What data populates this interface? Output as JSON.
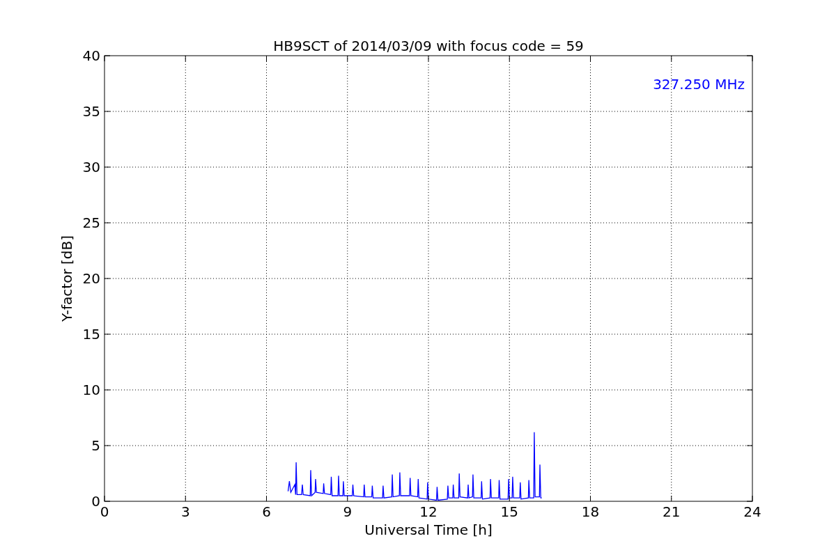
{
  "chart_data": {
    "type": "line",
    "title": "HB9SCT of 2014/03/09 with focus code = 59",
    "xlabel": "Universal Time [h]",
    "ylabel": "Y-factor [dB]",
    "xlim": [
      0,
      24
    ],
    "ylim": [
      0,
      40
    ],
    "xticks": [
      0,
      3,
      6,
      9,
      12,
      15,
      18,
      21,
      24
    ],
    "yticks": [
      0,
      5,
      10,
      15,
      20,
      25,
      30,
      35,
      40
    ],
    "grid": true,
    "annotations": [
      {
        "text": "327.250 MHz"
      }
    ],
    "x": [
      6.8,
      6.85,
      6.9,
      7.05,
      7.08,
      7.1,
      7.13,
      7.3,
      7.33,
      7.36,
      7.62,
      7.64,
      7.67,
      7.8,
      7.82,
      7.85,
      8.1,
      8.12,
      8.15,
      8.38,
      8.4,
      8.43,
      8.65,
      8.67,
      8.7,
      8.83,
      8.85,
      8.88,
      9.18,
      9.2,
      9.23,
      9.6,
      9.62,
      9.65,
      9.9,
      9.92,
      9.95,
      10.3,
      10.32,
      10.35,
      10.64,
      10.66,
      10.69,
      10.92,
      10.94,
      10.97,
      11.3,
      11.32,
      11.35,
      11.6,
      11.62,
      11.65,
      11.95,
      11.97,
      12.0,
      12.3,
      12.32,
      12.35,
      12.7,
      12.72,
      12.75,
      12.9,
      12.92,
      12.95,
      13.12,
      13.14,
      13.17,
      13.45,
      13.47,
      13.5,
      13.63,
      13.65,
      13.68,
      13.95,
      13.97,
      14.0,
      14.28,
      14.3,
      14.33,
      14.6,
      14.62,
      14.65,
      14.95,
      14.97,
      15.0,
      15.1,
      15.12,
      15.15,
      15.38,
      15.4,
      15.43,
      15.7,
      15.72,
      15.75,
      15.9,
      15.92,
      15.95,
      16.11,
      16.13,
      16.16,
      16.2
    ],
    "series": [
      {
        "color": "#0000ff",
        "values": [
          0.9,
          1.8,
          0.8,
          1.5,
          0.6,
          3.5,
          0.6,
          0.6,
          1.5,
          0.6,
          0.5,
          2.8,
          0.5,
          0.8,
          2.0,
          0.8,
          0.7,
          1.6,
          0.7,
          0.6,
          2.2,
          0.5,
          0.5,
          2.3,
          0.5,
          0.5,
          1.8,
          0.5,
          0.5,
          1.5,
          0.5,
          0.4,
          1.5,
          0.4,
          0.4,
          1.4,
          0.3,
          0.3,
          1.4,
          0.3,
          0.4,
          2.4,
          0.4,
          0.5,
          2.6,
          0.5,
          0.5,
          2.1,
          0.5,
          0.4,
          2.0,
          0.3,
          0.2,
          1.7,
          0.2,
          0.1,
          1.3,
          0.1,
          0.2,
          1.4,
          0.3,
          0.3,
          1.5,
          0.3,
          0.3,
          2.5,
          0.4,
          0.3,
          1.5,
          0.3,
          0.4,
          2.4,
          0.3,
          0.3,
          1.8,
          0.2,
          0.3,
          2.0,
          0.3,
          0.3,
          1.9,
          0.2,
          0.2,
          2.0,
          0.3,
          0.3,
          2.2,
          0.3,
          0.3,
          1.7,
          0.2,
          0.3,
          1.9,
          0.3,
          0.3,
          6.2,
          0.4,
          0.4,
          3.3,
          0.3,
          0.3
        ]
      }
    ]
  }
}
